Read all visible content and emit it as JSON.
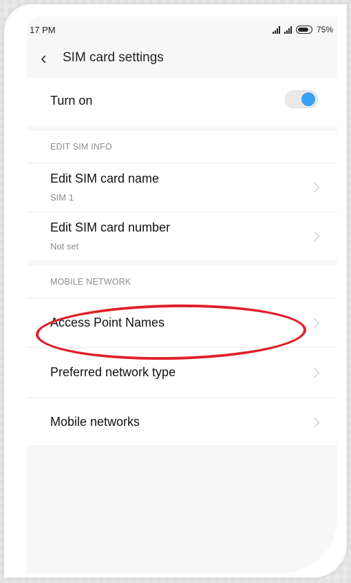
{
  "status_bar": {
    "time": "17 PM",
    "battery": "75%",
    "icons": [
      "signal-icon",
      "signal-icon",
      "battery-icon"
    ]
  },
  "header": {
    "title": "SIM card settings",
    "back_icon": "chevron-left-icon"
  },
  "turn_on": {
    "label": "Turn on",
    "toggle_state": "on",
    "accent": "#3aa0f3"
  },
  "edit_sim_info": {
    "heading": "EDIT SIM INFO",
    "items": [
      {
        "label": "Edit SIM card name",
        "sub": "SIM 1"
      },
      {
        "label": "Edit SIM card number",
        "sub": "Not set"
      }
    ]
  },
  "mobile_network": {
    "heading": "MOBILE NETWORK",
    "items": [
      {
        "label": "Access Point Names"
      },
      {
        "label": "Preferred network type"
      },
      {
        "label": "Mobile networks"
      }
    ]
  },
  "annotation": {
    "shape": "ellipse",
    "color": "#e0202a"
  }
}
